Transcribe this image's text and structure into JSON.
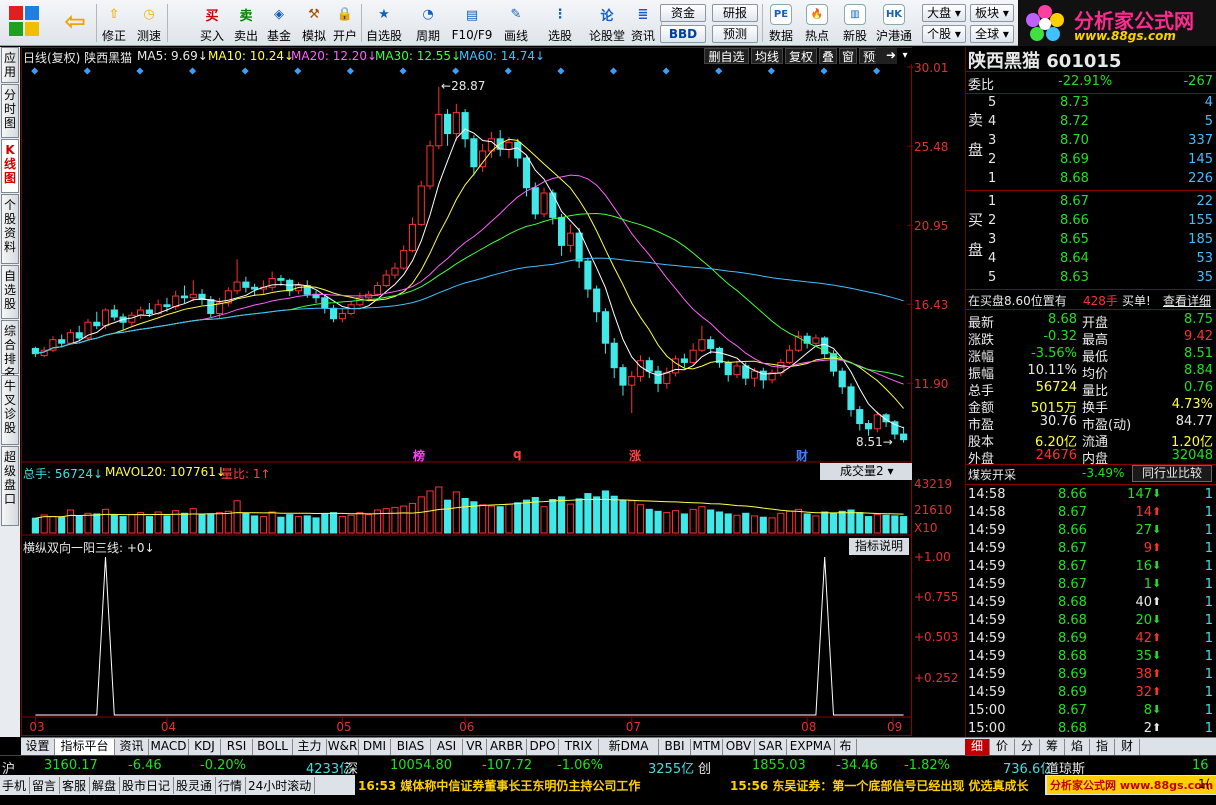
{
  "toolbar": {
    "buttons": [
      {
        "label": "修正",
        "icon": "up-arrow-icon",
        "glyph": "⇧",
        "color": "#f4b400"
      },
      {
        "label": "测速",
        "icon": "speed-icon",
        "glyph": "◷",
        "color": "#f4b400"
      },
      {
        "label": "买入",
        "icon": "buy-icon",
        "glyph": "买",
        "color": "#d00000"
      },
      {
        "label": "卖出",
        "icon": "sell-icon",
        "glyph": "卖",
        "color": "#008000"
      },
      {
        "label": "基金",
        "icon": "fund-icon",
        "glyph": "◈",
        "color": "#1060c0"
      },
      {
        "label": "模拟",
        "icon": "hammer-icon",
        "glyph": "⚒",
        "color": "#a05000"
      },
      {
        "label": "开户",
        "icon": "lock-icon",
        "glyph": "🔒",
        "color": "#806000"
      },
      {
        "label": "自选股",
        "icon": "star-icon",
        "glyph": "★",
        "color": "#1060c0"
      },
      {
        "label": "周期",
        "icon": "clock-icon",
        "glyph": "◔",
        "color": "#1060c0"
      },
      {
        "label": "F10/F9",
        "icon": "document-icon",
        "glyph": "▤",
        "color": "#1060c0"
      },
      {
        "label": "画线",
        "icon": "pencil-icon",
        "glyph": "✎",
        "color": "#1060c0"
      },
      {
        "label": "选股",
        "icon": "filter-icon",
        "glyph": "⋮",
        "color": "#1060c0"
      },
      {
        "label": "论股堂",
        "icon": "discuss-icon",
        "glyph": "论",
        "color": "#1060c0"
      },
      {
        "label": "资讯",
        "icon": "news-icon",
        "glyph": "≣",
        "color": "#1060c0"
      }
    ],
    "mid_buttons": {
      "zijin": "资金",
      "yanbao": "研报",
      "bbd": "BBD",
      "yuce": "预测"
    },
    "right_buttons": [
      {
        "label": "数据",
        "icon": "pe-icon",
        "glyph": "PE"
      },
      {
        "label": "热点",
        "icon": "fire-icon",
        "glyph": "🔥"
      },
      {
        "label": "新股",
        "icon": "new-stock-icon",
        "glyph": "▥"
      },
      {
        "label": "沪港通",
        "icon": "sse-hkex-icon",
        "glyph": "HK"
      }
    ],
    "dropdowns": {
      "dapan": "大盘",
      "bankuai": "板块",
      "gegu": "个股",
      "quanqiu": "全球"
    },
    "logo": {
      "title": "分析家公式网",
      "url": "www.88gs.com"
    }
  },
  "left_tabs": [
    "应用",
    "分时图",
    "K线图",
    "个股资料",
    "自选股",
    "综合排名",
    "牛叉诊股",
    "超级盘口"
  ],
  "chart_header": {
    "prefix": "日线(复权)  陕西黑猫",
    "ma5": "MA5: 9.69↓",
    "ma10": "MA10: 10.24↓",
    "ma20": "MA20: 12.20↓",
    "ma30": "MA30: 12.55↓",
    "ma60": "MA60: 14.74↓",
    "buttons": [
      "删自选",
      "均线",
      "复权",
      "叠",
      "窗",
      "预测"
    ]
  },
  "price_axis": [
    "30.01",
    "25.48",
    "20.95",
    "16.43",
    "11.90"
  ],
  "high_label": "28.87",
  "low_label": "8.51",
  "event_markers": [
    {
      "text": "榜",
      "color": "#ff40ff"
    },
    {
      "text": "q",
      "color": "#ff4040"
    },
    {
      "text": "涨",
      "color": "#ff4040"
    },
    {
      "text": "财",
      "color": "#4080ff"
    }
  ],
  "volume_header": {
    "total": "总手: 56724↓",
    "mavol": "MAVOL20: 107761↓",
    "ratio": "量比: 1↑",
    "select": "成交量2"
  },
  "volume_axis": [
    "43219",
    "21610",
    "X10"
  ],
  "indicator_header": {
    "name": "横纵双向一阳三线: +0↓",
    "help": "指标说明"
  },
  "indicator_axis": [
    "+1.00",
    "+0.755",
    "+0.503",
    "+0.252"
  ],
  "date_axis": [
    "03",
    "04",
    "05",
    "06",
    "07",
    "08",
    "09"
  ],
  "right_panel": {
    "title": "陕西黑猫 601015",
    "weibi": {
      "label": "委比",
      "pct": "-22.91%",
      "diff": "-267"
    },
    "sell_label": "卖盘",
    "buy_label": "买盘",
    "sell": [
      {
        "lvl": "5",
        "price": "8.73",
        "vol": "4"
      },
      {
        "lvl": "4",
        "price": "8.72",
        "vol": "5"
      },
      {
        "lvl": "3",
        "price": "8.70",
        "vol": "337"
      },
      {
        "lvl": "2",
        "price": "8.69",
        "vol": "145"
      },
      {
        "lvl": "1",
        "price": "8.68",
        "vol": "226"
      }
    ],
    "buy": [
      {
        "lvl": "1",
        "price": "8.67",
        "vol": "22"
      },
      {
        "lvl": "2",
        "price": "8.66",
        "vol": "155"
      },
      {
        "lvl": "3",
        "price": "8.65",
        "vol": "185"
      },
      {
        "lvl": "4",
        "price": "8.64",
        "vol": "53"
      },
      {
        "lvl": "5",
        "price": "8.63",
        "vol": "35"
      }
    ],
    "notice": {
      "text": "在买盘8.60位置有",
      "vol": "428手",
      "suffix": "买单!",
      "link": "查看详细"
    },
    "stats": [
      {
        "k1": "最新",
        "v1": "8.68",
        "c1": "grn",
        "k2": "开盘",
        "v2": "8.75",
        "c2": "grn"
      },
      {
        "k1": "涨跌",
        "v1": "-0.32",
        "c1": "grn",
        "k2": "最高",
        "v2": "9.42",
        "c2": "red"
      },
      {
        "k1": "涨幅",
        "v1": "-3.56%",
        "c1": "grn",
        "k2": "最低",
        "v2": "8.51",
        "c2": "grn"
      },
      {
        "k1": "振幅",
        "v1": "10.11%",
        "c1": "wht",
        "k2": "均价",
        "v2": "8.84",
        "c2": "grn"
      },
      {
        "k1": "总手",
        "v1": "56724",
        "c1": "yel",
        "k2": "量比",
        "v2": "0.76",
        "c2": "grn"
      },
      {
        "k1": "金额",
        "v1": "5015万",
        "c1": "yel",
        "k2": "换手",
        "v2": "4.73%",
        "c2": "yel"
      },
      {
        "k1": "市盈",
        "v1": "30.76",
        "c1": "wht",
        "k2": "市盈(动)",
        "v2": "84.77",
        "c2": "wht"
      },
      {
        "k1": "股本",
        "v1": "6.20亿",
        "c1": "yel",
        "k2": "流通",
        "v2": "1.20亿",
        "c2": "yel"
      },
      {
        "k1": "外盘",
        "v1": "24676",
        "c1": "red",
        "k2": "内盘",
        "v2": "32048",
        "c2": "grn"
      }
    ],
    "industry": {
      "name": "煤炭开采",
      "pct": "-3.49%",
      "button": "同行业比较"
    },
    "ticks": [
      {
        "t": "14:58",
        "p": "8.66",
        "v": "147",
        "d": "dn",
        "n": "1"
      },
      {
        "t": "14:58",
        "p": "8.67",
        "v": "14",
        "d": "up",
        "n": "1"
      },
      {
        "t": "14:59",
        "p": "8.66",
        "v": "27",
        "d": "dn",
        "n": "1"
      },
      {
        "t": "14:59",
        "p": "8.67",
        "v": "9",
        "d": "up",
        "n": "1"
      },
      {
        "t": "14:59",
        "p": "8.67",
        "v": "16",
        "d": "dn",
        "n": "1"
      },
      {
        "t": "14:59",
        "p": "8.67",
        "v": "1",
        "d": "dn",
        "n": "1"
      },
      {
        "t": "14:59",
        "p": "8.68",
        "v": "40",
        "d": "nu",
        "n": "1"
      },
      {
        "t": "14:59",
        "p": "8.68",
        "v": "20",
        "d": "dn",
        "n": "1"
      },
      {
        "t": "14:59",
        "p": "8.69",
        "v": "42",
        "d": "up",
        "n": "1"
      },
      {
        "t": "14:59",
        "p": "8.68",
        "v": "35",
        "d": "dn",
        "n": "1"
      },
      {
        "t": "14:59",
        "p": "8.69",
        "v": "38",
        "d": "up",
        "n": "1"
      },
      {
        "t": "14:59",
        "p": "8.69",
        "v": "32",
        "d": "up",
        "n": "1"
      },
      {
        "t": "15:00",
        "p": "8.67",
        "v": "8",
        "d": "dn",
        "n": "1"
      },
      {
        "t": "15:00",
        "p": "8.68",
        "v": "2",
        "d": "nu",
        "n": "1"
      }
    ],
    "tabs": [
      "细",
      "价",
      "分",
      "筹",
      "焰",
      "指",
      "财"
    ]
  },
  "bottom_tabs": [
    "设置",
    "指标平台",
    "资讯",
    "MACD",
    "KDJ",
    "RSI",
    "BOLL",
    "主力",
    "W&R",
    "DMI",
    "BIAS",
    "ASI",
    "VR",
    "ARBR",
    "DPO",
    "TRIX",
    "新DMA",
    "BBI",
    "MTM",
    "OBV",
    "SAR",
    "EXPMA",
    "布"
  ],
  "status": {
    "sh": "沪",
    "sh_idx": "3160.17",
    "sh_chg": "-6.46",
    "sh_pct": "-0.20%",
    "sh_amt": "4233亿",
    "sz": "深",
    "sz_idx": "10054.80",
    "sz_chg": "-107.72",
    "sz_pct": "-1.06%",
    "sz_amt": "3255亿",
    "cy": "创",
    "cy_idx": "1855.03",
    "cy_chg": "-34.46",
    "cy_pct": "-1.82%",
    "cy_amt": "736.6亿",
    "dj": "道琼斯",
    "dj_val": "16"
  },
  "status2": {
    "items": [
      "手机",
      "留言",
      "客服",
      "解盘",
      "股市日记",
      "股灵通",
      "行情",
      "24小时滚动"
    ],
    "news1": "16:53 媒体称中信证券董事长王东明仍主持公司工作",
    "news2": "15:56 东吴证券：第一个底部信号已经出现 优选真成长",
    "badge": "分析家公式网 www.88gs.com",
    "tail": "1("
  },
  "chart_data": {
    "type": "candlestick",
    "price_range": [
      7.4,
      30.01
    ],
    "candles": [
      [
        13.9,
        13.6,
        14.0,
        13.4
      ],
      [
        13.5,
        13.8,
        14.0,
        13.4
      ],
      [
        13.8,
        14.4,
        14.6,
        13.7
      ],
      [
        14.4,
        14.2,
        14.7,
        14.0
      ],
      [
        14.2,
        14.8,
        15.0,
        14.1
      ],
      [
        14.8,
        14.5,
        15.2,
        14.3
      ],
      [
        14.5,
        15.4,
        15.6,
        14.4
      ],
      [
        15.4,
        15.2,
        16.0,
        15.0
      ],
      [
        15.2,
        16.1,
        16.2,
        15.0
      ],
      [
        16.1,
        15.7,
        16.4,
        15.5
      ],
      [
        15.7,
        15.4,
        15.9,
        15.0
      ],
      [
        15.4,
        15.8,
        16.0,
        15.2
      ],
      [
        15.8,
        16.1,
        16.3,
        15.6
      ],
      [
        16.1,
        15.9,
        16.5,
        15.7
      ],
      [
        15.9,
        16.4,
        16.7,
        15.8
      ],
      [
        16.4,
        16.3,
        16.8,
        16.0
      ],
      [
        16.3,
        16.9,
        17.2,
        16.1
      ],
      [
        16.9,
        16.8,
        17.5,
        16.5
      ],
      [
        16.8,
        17.0,
        17.8,
        16.6
      ],
      [
        17.0,
        16.7,
        17.3,
        16.4
      ],
      [
        16.7,
        15.9,
        16.9,
        15.7
      ],
      [
        15.9,
        16.5,
        16.8,
        15.6
      ],
      [
        16.5,
        17.2,
        17.4,
        16.3
      ],
      [
        17.2,
        17.7,
        19.0,
        17.0
      ],
      [
        17.7,
        17.4,
        18.0,
        17.1
      ],
      [
        17.4,
        17.3,
        17.6,
        16.9
      ],
      [
        17.3,
        17.4,
        17.8,
        17.0
      ],
      [
        17.4,
        17.9,
        18.3,
        17.2
      ],
      [
        17.9,
        17.8,
        18.1,
        17.5
      ],
      [
        17.8,
        17.2,
        17.9,
        16.9
      ],
      [
        17.2,
        17.5,
        17.7,
        17.0
      ],
      [
        17.5,
        17.0,
        17.8,
        16.8
      ],
      [
        17.0,
        16.8,
        17.2,
        16.5
      ],
      [
        16.8,
        16.2,
        17.0,
        15.9
      ],
      [
        16.2,
        15.6,
        16.4,
        15.4
      ],
      [
        15.6,
        15.9,
        16.2,
        15.4
      ],
      [
        15.9,
        16.4,
        16.6,
        15.8
      ],
      [
        16.4,
        16.8,
        17.1,
        16.3
      ],
      [
        16.8,
        17.0,
        17.2,
        16.6
      ],
      [
        17.0,
        17.5,
        17.7,
        16.9
      ],
      [
        17.5,
        18.1,
        18.4,
        17.4
      ],
      [
        18.1,
        18.5,
        18.8,
        17.9
      ],
      [
        18.5,
        19.5,
        19.8,
        18.4
      ],
      [
        19.5,
        21.0,
        21.4,
        19.4
      ],
      [
        21.0,
        23.2,
        23.5,
        20.9
      ],
      [
        23.2,
        25.5,
        25.8,
        23.0
      ],
      [
        25.5,
        27.3,
        28.87,
        25.3
      ],
      [
        27.3,
        26.2,
        27.6,
        25.5
      ],
      [
        26.2,
        27.4,
        27.9,
        25.8
      ],
      [
        27.4,
        25.9,
        27.6,
        25.4
      ],
      [
        25.9,
        24.3,
        26.1,
        23.8
      ],
      [
        24.3,
        25.2,
        25.6,
        24.0
      ],
      [
        25.2,
        25.9,
        26.3,
        24.8
      ],
      [
        25.9,
        25.3,
        26.4,
        24.9
      ],
      [
        25.3,
        25.7,
        26.0,
        24.8
      ],
      [
        25.7,
        24.8,
        25.9,
        24.3
      ],
      [
        24.8,
        23.1,
        24.9,
        22.6
      ],
      [
        23.1,
        21.6,
        23.4,
        21.3
      ],
      [
        21.6,
        22.8,
        23.1,
        21.4
      ],
      [
        22.8,
        21.4,
        23.0,
        21.0
      ],
      [
        21.4,
        19.8,
        21.6,
        19.2
      ],
      [
        19.8,
        20.5,
        21.0,
        19.4
      ],
      [
        20.5,
        18.9,
        20.8,
        18.5
      ],
      [
        18.9,
        17.3,
        19.1,
        16.8
      ],
      [
        17.3,
        16.0,
        17.5,
        15.4
      ],
      [
        16.0,
        14.2,
        16.2,
        13.6
      ],
      [
        14.2,
        12.8,
        14.5,
        12.2
      ],
      [
        12.8,
        11.8,
        13.0,
        11.2
      ],
      [
        11.8,
        12.3,
        12.6,
        10.2
      ],
      [
        12.3,
        13.2,
        13.5,
        12.0
      ],
      [
        13.2,
        12.6,
        13.4,
        12.2
      ],
      [
        12.6,
        11.9,
        12.9,
        11.4
      ],
      [
        11.9,
        12.5,
        12.8,
        11.6
      ],
      [
        12.5,
        13.3,
        13.5,
        12.3
      ],
      [
        13.3,
        13.1,
        13.6,
        12.8
      ],
      [
        13.1,
        13.8,
        14.2,
        13.0
      ],
      [
        13.8,
        14.4,
        15.2,
        13.7
      ],
      [
        14.4,
        13.9,
        14.6,
        13.6
      ],
      [
        13.9,
        13.1,
        14.0,
        12.8
      ],
      [
        13.1,
        12.4,
        13.2,
        12.0
      ],
      [
        12.4,
        12.9,
        13.2,
        12.2
      ],
      [
        12.9,
        12.2,
        13.1,
        11.8
      ],
      [
        12.2,
        12.6,
        12.8,
        11.7
      ],
      [
        12.6,
        12.1,
        12.8,
        11.6
      ],
      [
        12.1,
        12.5,
        12.7,
        11.9
      ],
      [
        12.5,
        13.1,
        13.3,
        12.3
      ],
      [
        13.1,
        13.8,
        14.1,
        13.0
      ],
      [
        13.8,
        14.6,
        14.9,
        13.7
      ],
      [
        14.6,
        14.2,
        14.8,
        13.9
      ],
      [
        14.2,
        14.5,
        14.7,
        14.0
      ],
      [
        14.5,
        13.6,
        14.6,
        13.3
      ],
      [
        13.6,
        12.6,
        13.8,
        12.3
      ],
      [
        12.6,
        11.7,
        12.8,
        11.3
      ],
      [
        11.7,
        10.4,
        11.9,
        10.0
      ],
      [
        10.4,
        9.6,
        10.6,
        9.2
      ],
      [
        9.6,
        9.3,
        9.8,
        8.9
      ],
      [
        9.3,
        10.1,
        10.3,
        9.1
      ],
      [
        10.1,
        9.7,
        10.2,
        9.4
      ],
      [
        9.7,
        9.0,
        9.8,
        8.7
      ],
      [
        9.0,
        8.68,
        9.42,
        8.51
      ]
    ],
    "volume": [
      45,
      55,
      50,
      48,
      70,
      52,
      60,
      58,
      72,
      55,
      50,
      56,
      62,
      50,
      64,
      52,
      68,
      60,
      74,
      56,
      58,
      62,
      66,
      98,
      60,
      52,
      50,
      64,
      48,
      56,
      50,
      52,
      46,
      58,
      62,
      50,
      54,
      62,
      56,
      70,
      74,
      78,
      82,
      90,
      110,
      128,
      140,
      100,
      125,
      105,
      95,
      86,
      82,
      80,
      88,
      92,
      100,
      108,
      80,
      102,
      110,
      88,
      104,
      120,
      110,
      128,
      112,
      100,
      98,
      86,
      72,
      66,
      62,
      68,
      58,
      72,
      80,
      70,
      64,
      58,
      54,
      60,
      52,
      48,
      46,
      60,
      66,
      72,
      58,
      52,
      64,
      60,
      66,
      70,
      62,
      50,
      56,
      54,
      52,
      50
    ],
    "indicator_spikes": [
      {
        "index": 8,
        "value": 1.0
      },
      {
        "index": 90,
        "value": 1.0
      }
    ],
    "moving_averages": [
      "MA5",
      "MA10",
      "MA20",
      "MA30",
      "MA60"
    ],
    "ma_colors": {
      "MA5": "#ffffff",
      "MA10": "#ffff40",
      "MA20": "#ff60ff",
      "MA30": "#40ff40",
      "MA60": "#40c0ff"
    }
  }
}
